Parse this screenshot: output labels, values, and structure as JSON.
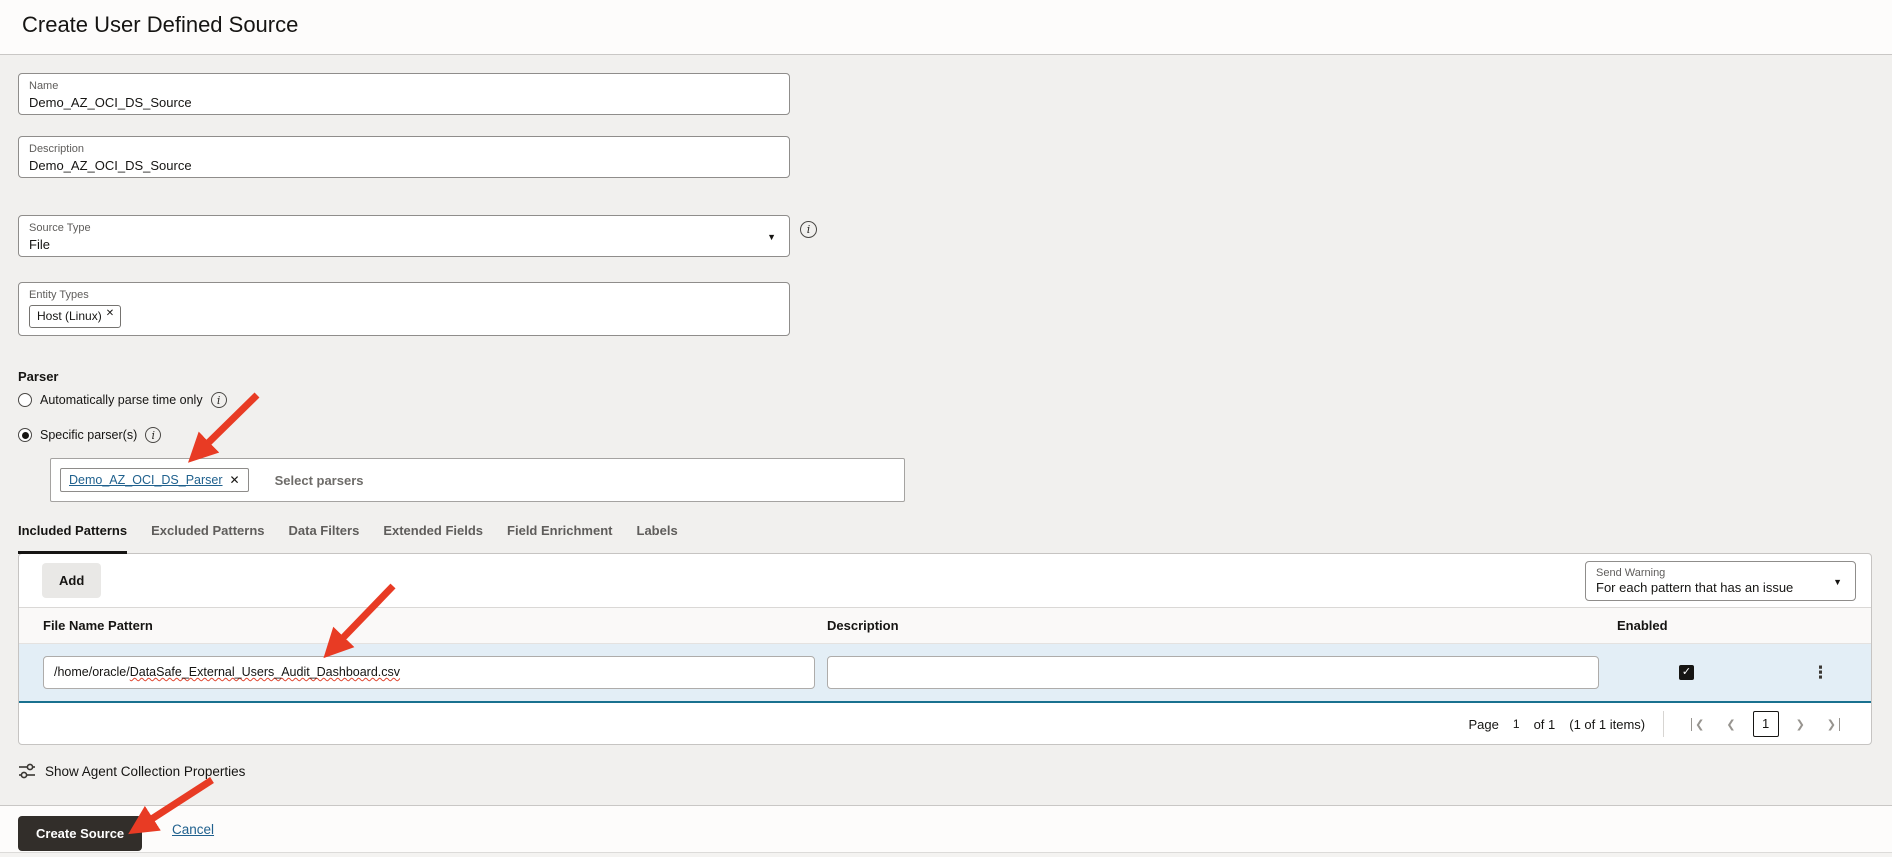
{
  "page": {
    "title": "Create User Defined Source"
  },
  "form": {
    "name": {
      "label": "Name",
      "value": "Demo_AZ_OCI_DS_Source"
    },
    "description": {
      "label": "Description",
      "value": "Demo_AZ_OCI_DS_Source"
    },
    "source_type": {
      "label": "Source Type",
      "value": "File"
    },
    "entity_types": {
      "label": "Entity Types",
      "chips": [
        {
          "label": "Host (Linux)"
        }
      ]
    },
    "parser": {
      "heading": "Parser",
      "options": [
        {
          "label": "Automatically parse time only",
          "selected": false
        },
        {
          "label": "Specific parser(s)",
          "selected": true
        }
      ],
      "selected_parsers": [
        {
          "label": "Demo_AZ_OCI_DS_Parser"
        }
      ],
      "placeholder": "Select parsers"
    }
  },
  "tabs": [
    {
      "label": "Included Patterns",
      "active": true
    },
    {
      "label": "Excluded Patterns",
      "active": false
    },
    {
      "label": "Data Filters",
      "active": false
    },
    {
      "label": "Extended Fields",
      "active": false
    },
    {
      "label": "Field Enrichment",
      "active": false
    },
    {
      "label": "Labels",
      "active": false
    }
  ],
  "patterns": {
    "add_button": "Add",
    "send_warning": {
      "label": "Send Warning",
      "value": "For each pattern that has an issue"
    },
    "columns": {
      "file_name": "File Name Pattern",
      "description": "Description",
      "enabled": "Enabled"
    },
    "rows": [
      {
        "file_name_prefix": "/home/oracle/",
        "file_name_highlighted": "DataSafe_External_Users_Audit_Dashboard.csv",
        "description": "",
        "enabled": true
      }
    ],
    "pagination": {
      "page_label": "Page",
      "current": "1",
      "of_total": "of 1",
      "items_summary": "(1 of 1 items)"
    }
  },
  "agent_properties": {
    "label": "Show Agent Collection Properties"
  },
  "footer": {
    "create_button": "Create Source",
    "cancel_link": "Cancel"
  },
  "icons": {
    "dropdown_caret": "▼",
    "info": "i",
    "remove": "✕",
    "check": "✓",
    "kebab": "⋮",
    "pg_first": "❮",
    "pg_prev": "❮",
    "pg_next": "❯",
    "pg_last": "❯"
  },
  "colors": {
    "arrow_red": "#e83b24",
    "link_teal": "#20618e",
    "row_highlight": "#e3eef6",
    "row_border": "#19718f",
    "primary_button_bg": "#322e2a"
  }
}
